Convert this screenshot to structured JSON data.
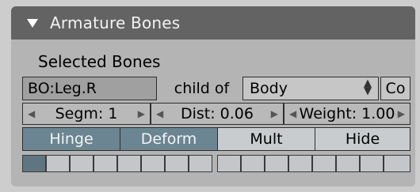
{
  "panel": {
    "title": "Armature Bones",
    "section_label": "Selected Bones",
    "bone_name": "BO:Leg.R",
    "child_of_label": "child of",
    "parent_value": "Body",
    "connect_label": "Co",
    "segm_label": "Segm: 1",
    "dist_label": "Dist: 0.06",
    "weight_label": "Weight: 1.00",
    "toggles": {
      "hinge": "Hinge",
      "deform": "Deform",
      "mult": "Mult",
      "hide": "Hide"
    },
    "hinge_on": true,
    "deform_on": true,
    "mult_on": false,
    "hide_on": false,
    "layers_active": [
      1
    ]
  },
  "colors": {
    "header_bg": "#636363",
    "toggle_on": "#6b8592",
    "toggle_off": "#c8ccce",
    "panel_bg": "#b4b4b4"
  }
}
